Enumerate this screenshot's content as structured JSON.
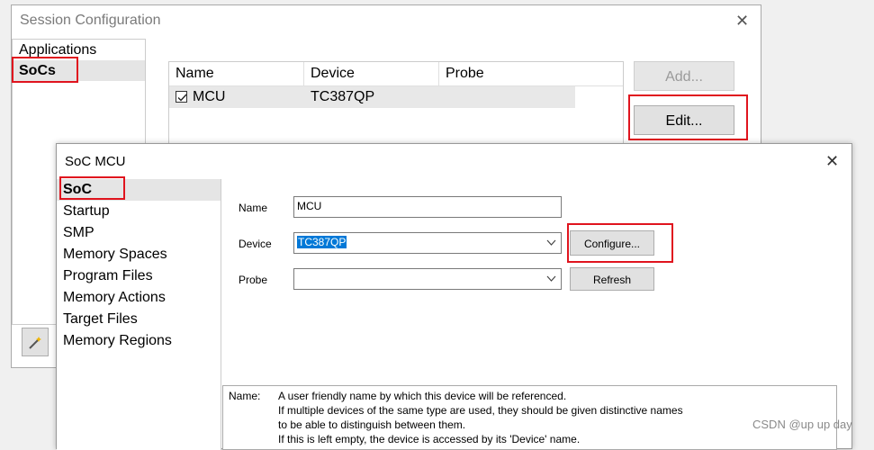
{
  "session_window": {
    "title": "Session Configuration",
    "left_list": [
      "Applications",
      "SoCs"
    ],
    "selected_left": "SoCs",
    "table": {
      "headers": [
        "Name",
        "Device",
        "Probe"
      ],
      "rows": [
        {
          "checked": true,
          "name": "MCU",
          "device": "TC387QP",
          "probe": ""
        }
      ]
    },
    "buttons": {
      "add": "Add...",
      "edit": "Edit..."
    },
    "close": "✕"
  },
  "soc_window": {
    "title": "SoC MCU",
    "close": "✕",
    "nav": [
      "SoC",
      "Startup",
      "SMP",
      "Memory Spaces",
      "Program Files",
      "Memory Actions",
      "Target Files",
      "Memory Regions"
    ],
    "selected_nav": "SoC",
    "form": {
      "name_label": "Name",
      "name_value": "MCU",
      "device_label": "Device",
      "device_value": "TC387QP",
      "probe_label": "Probe",
      "probe_value": "",
      "configure_button": "Configure...",
      "refresh_button": "Refresh"
    },
    "help": {
      "label": "Name:",
      "lines": [
        "A user friendly name by which this device will be referenced.",
        "If multiple devices of the same type are used, they should be given distinctive names",
        "to be able to distinguish between them.",
        "If this is left empty, the device is accessed by its 'Device' name."
      ]
    }
  },
  "watermark": "CSDN @up up day",
  "highlight_color": "#e0141e"
}
